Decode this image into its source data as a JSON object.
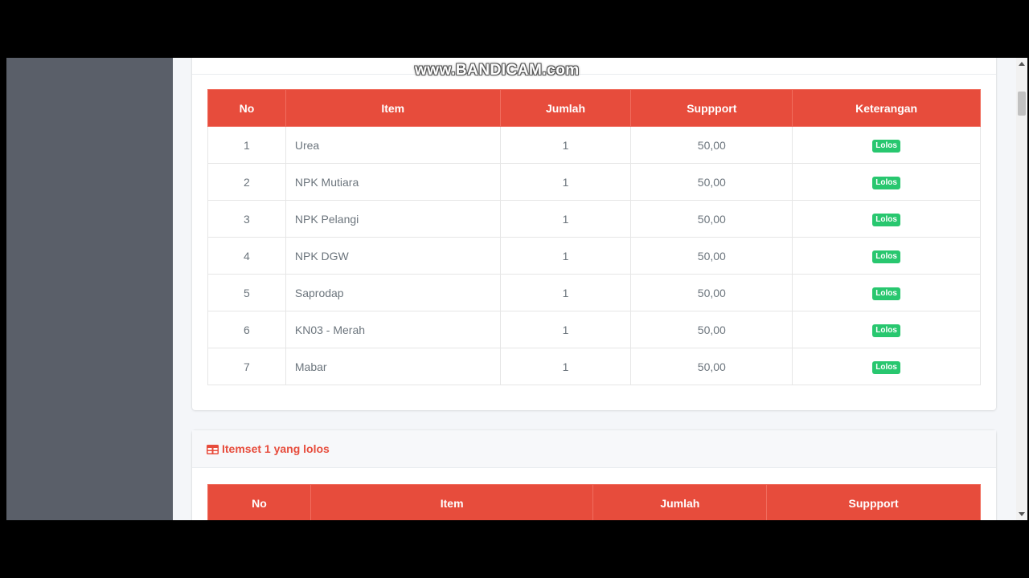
{
  "watermark": "www.BANDICAM.com",
  "table1": {
    "headers": [
      "No",
      "Item",
      "Jumlah",
      "Suppport",
      "Keterangan"
    ],
    "rows": [
      {
        "no": "1",
        "item": "Urea",
        "jumlah": "1",
        "support": "50,00",
        "status": "Lolos"
      },
      {
        "no": "2",
        "item": "NPK Mutiara",
        "jumlah": "1",
        "support": "50,00",
        "status": "Lolos"
      },
      {
        "no": "3",
        "item": "NPK Pelangi",
        "jumlah": "1",
        "support": "50,00",
        "status": "Lolos"
      },
      {
        "no": "4",
        "item": "NPK DGW",
        "jumlah": "1",
        "support": "50,00",
        "status": "Lolos"
      },
      {
        "no": "5",
        "item": "Saprodap",
        "jumlah": "1",
        "support": "50,00",
        "status": "Lolos"
      },
      {
        "no": "6",
        "item": "KN03 - Merah",
        "jumlah": "1",
        "support": "50,00",
        "status": "Lolos"
      },
      {
        "no": "7",
        "item": "Mabar",
        "jumlah": "1",
        "support": "50,00",
        "status": "Lolos"
      }
    ]
  },
  "itemset_card": {
    "icon": "table-icon",
    "title": "Itemset 1 yang lolos",
    "headers": [
      "No",
      "Item",
      "Jumlah",
      "Suppport"
    ]
  },
  "colors": {
    "header_red": "#e74c3c",
    "badge_green": "#28c76f",
    "sidebar": "#5a5f69"
  }
}
